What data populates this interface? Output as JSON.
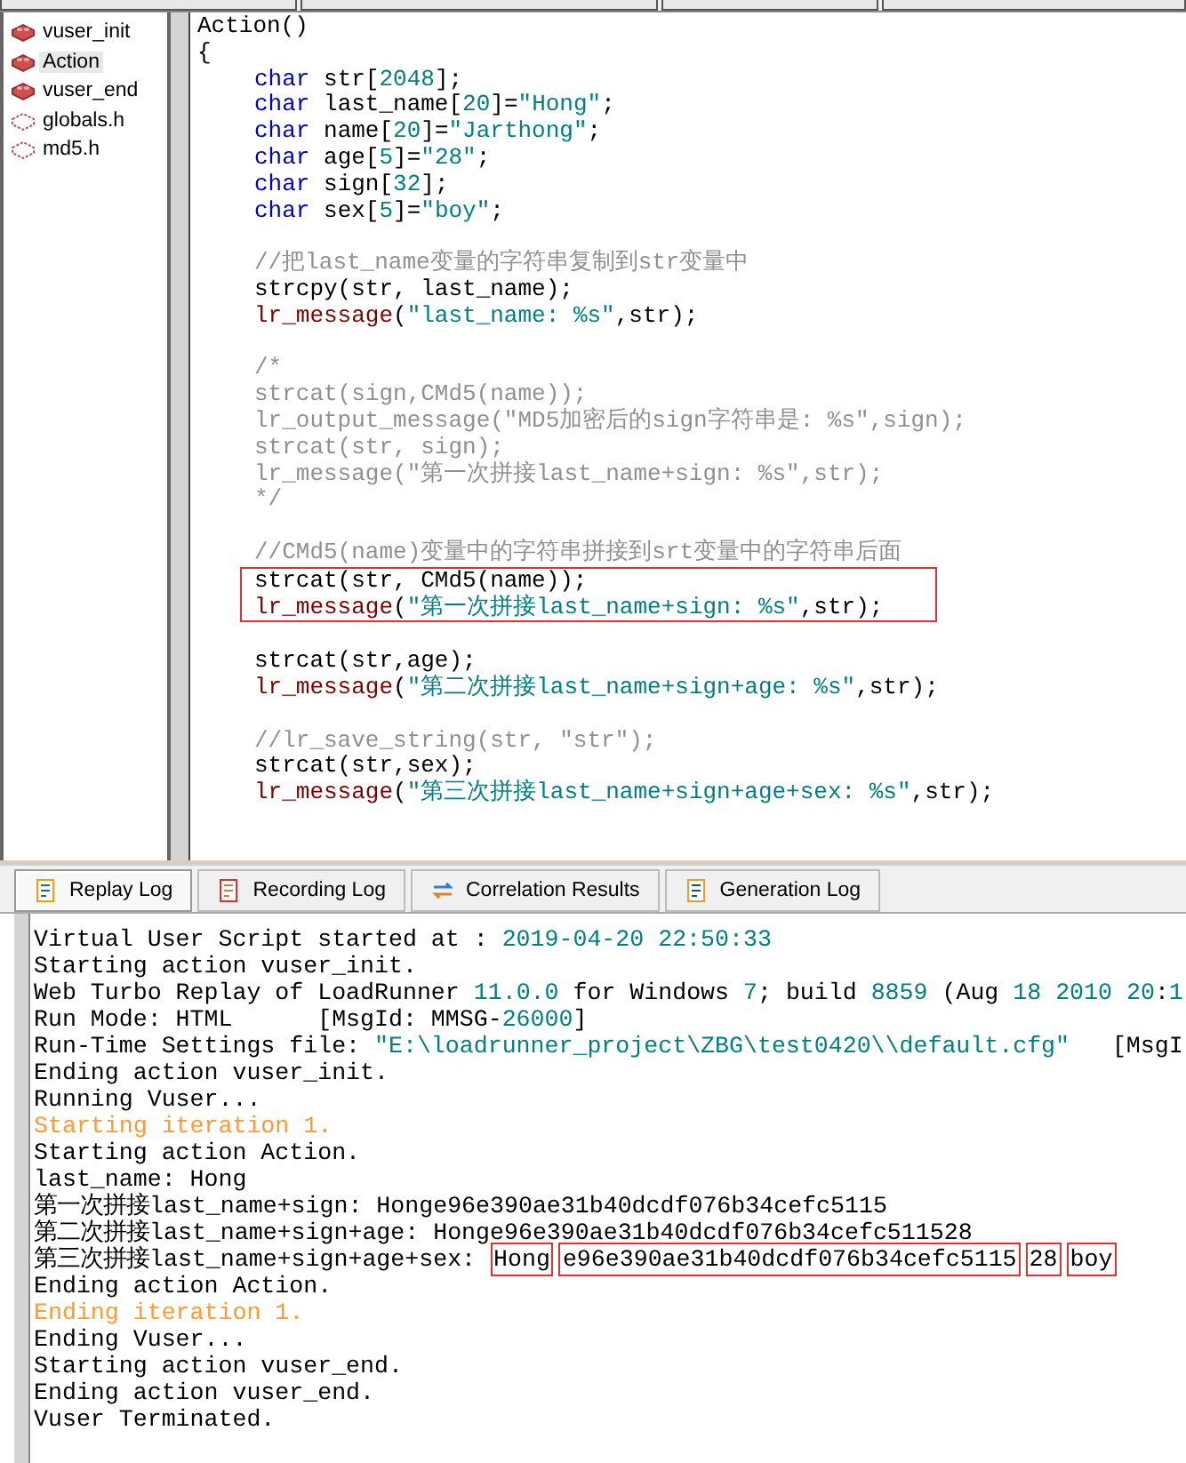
{
  "files": [
    {
      "name": "vuser_init",
      "kind": "action",
      "selected": false
    },
    {
      "name": "Action",
      "kind": "action",
      "selected": true
    },
    {
      "name": "vuser_end",
      "kind": "action",
      "selected": false
    },
    {
      "name": "globals.h",
      "kind": "header",
      "selected": false
    },
    {
      "name": "md5.h",
      "kind": "header",
      "selected": false
    }
  ],
  "code_lines": [
    {
      "kind": "code",
      "indented": false,
      "boxed": false,
      "tokens": [
        {
          "kind": "plain",
          "text": "Action()"
        }
      ]
    },
    {
      "kind": "code",
      "indented": false,
      "boxed": false,
      "tokens": [
        {
          "kind": "plain",
          "text": "{"
        }
      ]
    },
    {
      "kind": "code",
      "indented": true,
      "boxed": false,
      "tokens": [
        {
          "kind": "keyword",
          "text": "char"
        },
        {
          "kind": "plain",
          "text": " str["
        },
        {
          "kind": "number",
          "text": "2048"
        },
        {
          "kind": "plain",
          "text": "];"
        }
      ]
    },
    {
      "kind": "code",
      "indented": true,
      "boxed": false,
      "tokens": [
        {
          "kind": "keyword",
          "text": "char"
        },
        {
          "kind": "plain",
          "text": " last_name["
        },
        {
          "kind": "number",
          "text": "20"
        },
        {
          "kind": "plain",
          "text": "]="
        },
        {
          "kind": "string",
          "text": "\"Hong\""
        },
        {
          "kind": "plain",
          "text": ";"
        }
      ]
    },
    {
      "kind": "code",
      "indented": true,
      "boxed": false,
      "tokens": [
        {
          "kind": "keyword",
          "text": "char"
        },
        {
          "kind": "plain",
          "text": " name["
        },
        {
          "kind": "number",
          "text": "20"
        },
        {
          "kind": "plain",
          "text": "]="
        },
        {
          "kind": "string",
          "text": "\"Jarthong\""
        },
        {
          "kind": "plain",
          "text": ";"
        }
      ]
    },
    {
      "kind": "code",
      "indented": true,
      "boxed": false,
      "tokens": [
        {
          "kind": "keyword",
          "text": "char"
        },
        {
          "kind": "plain",
          "text": " age["
        },
        {
          "kind": "number",
          "text": "5"
        },
        {
          "kind": "plain",
          "text": "]="
        },
        {
          "kind": "string",
          "text": "\"28\""
        },
        {
          "kind": "plain",
          "text": ";"
        }
      ]
    },
    {
      "kind": "code",
      "indented": true,
      "boxed": false,
      "tokens": [
        {
          "kind": "keyword",
          "text": "char"
        },
        {
          "kind": "plain",
          "text": " sign["
        },
        {
          "kind": "number",
          "text": "32"
        },
        {
          "kind": "plain",
          "text": "];"
        }
      ]
    },
    {
      "kind": "code",
      "indented": true,
      "boxed": false,
      "tokens": [
        {
          "kind": "keyword",
          "text": "char"
        },
        {
          "kind": "plain",
          "text": " sex["
        },
        {
          "kind": "number",
          "text": "5"
        },
        {
          "kind": "plain",
          "text": "]="
        },
        {
          "kind": "string",
          "text": "\"boy\""
        },
        {
          "kind": "plain",
          "text": ";"
        }
      ]
    },
    {
      "kind": "blank"
    },
    {
      "kind": "code",
      "indented": true,
      "boxed": false,
      "tokens": [
        {
          "kind": "comment",
          "text": "//把last_name变量的字符串复制到str变量中"
        }
      ]
    },
    {
      "kind": "code",
      "indented": true,
      "boxed": false,
      "tokens": [
        {
          "kind": "plain",
          "text": "strcpy(str, last_name);"
        }
      ]
    },
    {
      "kind": "code",
      "indented": true,
      "boxed": false,
      "tokens": [
        {
          "kind": "func",
          "text": "lr_message"
        },
        {
          "kind": "plain",
          "text": "("
        },
        {
          "kind": "string",
          "text": "\"last_name: %s\""
        },
        {
          "kind": "plain",
          "text": ",str);"
        }
      ]
    },
    {
      "kind": "blank"
    },
    {
      "kind": "code",
      "indented": true,
      "boxed": false,
      "tokens": [
        {
          "kind": "comment",
          "text": "/*"
        }
      ]
    },
    {
      "kind": "code",
      "indented": true,
      "boxed": false,
      "tokens": [
        {
          "kind": "comment",
          "text": "strcat(sign,CMd5(name));"
        }
      ]
    },
    {
      "kind": "code",
      "indented": true,
      "boxed": false,
      "tokens": [
        {
          "kind": "comment",
          "text": "lr_output_message(\"MD5加密后的sign字符串是: %s\",sign);"
        }
      ]
    },
    {
      "kind": "code",
      "indented": true,
      "boxed": false,
      "tokens": [
        {
          "kind": "comment",
          "text": "strcat(str, sign);"
        }
      ]
    },
    {
      "kind": "code",
      "indented": true,
      "boxed": false,
      "tokens": [
        {
          "kind": "comment",
          "text": "lr_message(\"第一次拼接last_name+sign: %s\",str);"
        }
      ]
    },
    {
      "kind": "code",
      "indented": true,
      "boxed": false,
      "tokens": [
        {
          "kind": "comment",
          "text": "*/"
        }
      ]
    },
    {
      "kind": "blank"
    },
    {
      "kind": "code",
      "indented": true,
      "boxed": false,
      "tokens": [
        {
          "kind": "comment",
          "text": "//CMd5(name)变量中的字符串拼接到srt变量中的字符串后面"
        }
      ]
    },
    {
      "kind": "code",
      "indented": true,
      "boxed": true,
      "tokens": [
        {
          "kind": "plain",
          "text": "strcat(str, CMd5(name));"
        }
      ]
    },
    {
      "kind": "code",
      "indented": true,
      "boxed": true,
      "tokens": [
        {
          "kind": "func",
          "text": "lr_message"
        },
        {
          "kind": "plain",
          "text": "("
        },
        {
          "kind": "string",
          "text": "\"第一次拼接last_name+sign: %s\""
        },
        {
          "kind": "plain",
          "text": ",str);"
        }
      ]
    },
    {
      "kind": "blank"
    },
    {
      "kind": "code",
      "indented": true,
      "boxed": false,
      "tokens": [
        {
          "kind": "plain",
          "text": "strcat(str,age);"
        }
      ]
    },
    {
      "kind": "code",
      "indented": true,
      "boxed": false,
      "tokens": [
        {
          "kind": "func",
          "text": "lr_message"
        },
        {
          "kind": "plain",
          "text": "("
        },
        {
          "kind": "string",
          "text": "\"第二次拼接last_name+sign+age: %s\""
        },
        {
          "kind": "plain",
          "text": ",str);"
        }
      ]
    },
    {
      "kind": "blank"
    },
    {
      "kind": "code",
      "indented": true,
      "boxed": false,
      "tokens": [
        {
          "kind": "comment",
          "text": "//lr_save_string(str, \"str\");"
        }
      ]
    },
    {
      "kind": "code",
      "indented": true,
      "boxed": false,
      "tokens": [
        {
          "kind": "plain",
          "text": "strcat(str,sex);"
        }
      ]
    },
    {
      "kind": "code",
      "indented": true,
      "boxed": false,
      "tokens": [
        {
          "kind": "func",
          "text": "lr_message"
        },
        {
          "kind": "plain",
          "text": "("
        },
        {
          "kind": "string",
          "text": "\"第三次拼接last_name+sign+age+sex: %s\""
        },
        {
          "kind": "plain",
          "text": ",str);"
        }
      ]
    }
  ],
  "log_tabs": [
    {
      "label": "Replay Log",
      "kind": "replay",
      "selected": true
    },
    {
      "label": "Recording Log",
      "kind": "recording",
      "selected": false
    },
    {
      "label": "Correlation Results",
      "kind": "correlation",
      "selected": false
    },
    {
      "label": "Generation Log",
      "kind": "generation",
      "selected": false
    }
  ],
  "log_lines": [
    {
      "kind": "normal",
      "tokens": [
        {
          "kind": "plain",
          "text": "Virtual User Script started at : "
        },
        {
          "kind": "number",
          "text": "2019-04-20 22:50:33"
        }
      ]
    },
    {
      "kind": "normal",
      "tokens": [
        {
          "kind": "plain",
          "text": "Starting action vuser_init."
        }
      ]
    },
    {
      "kind": "normal",
      "tokens": [
        {
          "kind": "plain",
          "text": "Web Turbo Replay of LoadRunner "
        },
        {
          "kind": "number",
          "text": "11.0.0"
        },
        {
          "kind": "plain",
          "text": " for Windows "
        },
        {
          "kind": "number",
          "text": "7"
        },
        {
          "kind": "plain",
          "text": "; build "
        },
        {
          "kind": "number",
          "text": "8859"
        },
        {
          "kind": "plain",
          "text": " (Aug "
        },
        {
          "kind": "number",
          "text": "18 2010 20"
        },
        {
          "kind": "plain",
          "text": ":"
        },
        {
          "kind": "number",
          "text": "1"
        }
      ]
    },
    {
      "kind": "normal",
      "tokens": [
        {
          "kind": "plain",
          "text": "Run Mode: HTML      [MsgId: MMSG-"
        },
        {
          "kind": "number",
          "text": "26000"
        },
        {
          "kind": "plain",
          "text": "]"
        }
      ]
    },
    {
      "kind": "normal",
      "tokens": [
        {
          "kind": "plain",
          "text": "Run-Time Settings file: "
        },
        {
          "kind": "number",
          "text": "\"E:\\loadrunner_project\\ZBG\\test0420\\\\default.cfg\""
        },
        {
          "kind": "plain",
          "text": "   [MsgI"
        }
      ]
    },
    {
      "kind": "normal",
      "tokens": [
        {
          "kind": "plain",
          "text": "Ending action vuser_init."
        }
      ]
    },
    {
      "kind": "normal",
      "tokens": [
        {
          "kind": "plain",
          "text": "Running Vuser..."
        }
      ]
    },
    {
      "kind": "iteration",
      "tokens": [
        {
          "kind": "plain",
          "text": "Starting iteration 1."
        }
      ]
    },
    {
      "kind": "normal",
      "tokens": [
        {
          "kind": "plain",
          "text": "Starting action Action."
        }
      ]
    },
    {
      "kind": "normal",
      "tokens": [
        {
          "kind": "plain",
          "text": "last_name: Hong"
        }
      ]
    },
    {
      "kind": "normal",
      "tokens": [
        {
          "kind": "plain",
          "text": "第一次拼接last_name+sign: Honge96e390ae31b40dcdf076b34cefc5115"
        }
      ]
    },
    {
      "kind": "normal",
      "tokens": [
        {
          "kind": "plain",
          "text": "第二次拼接last_name+sign+age: Honge96e390ae31b40dcdf076b34cefc511528"
        }
      ]
    },
    {
      "kind": "normal",
      "tokens": [
        {
          "kind": "plain",
          "text": "第三次拼接last_name+sign+age+sex: "
        },
        {
          "kind": "boxed",
          "text": "Hong"
        },
        {
          "kind": "boxed",
          "text": "e96e390ae31b40dcdf076b34cefc5115"
        },
        {
          "kind": "boxed",
          "text": "28"
        },
        {
          "kind": "boxed",
          "text": "boy"
        }
      ]
    },
    {
      "kind": "normal",
      "tokens": [
        {
          "kind": "plain",
          "text": "Ending action Action."
        }
      ]
    },
    {
      "kind": "iteration",
      "tokens": [
        {
          "kind": "plain",
          "text": "Ending iteration 1."
        }
      ]
    },
    {
      "kind": "normal",
      "tokens": [
        {
          "kind": "plain",
          "text": "Ending Vuser..."
        }
      ]
    },
    {
      "kind": "normal",
      "tokens": [
        {
          "kind": "plain",
          "text": "Starting action vuser_end."
        }
      ]
    },
    {
      "kind": "normal",
      "tokens": [
        {
          "kind": "plain",
          "text": "Ending action vuser_end."
        }
      ]
    },
    {
      "kind": "normal",
      "tokens": [
        {
          "kind": "plain",
          "text": "Vuser Terminated."
        }
      ]
    }
  ]
}
